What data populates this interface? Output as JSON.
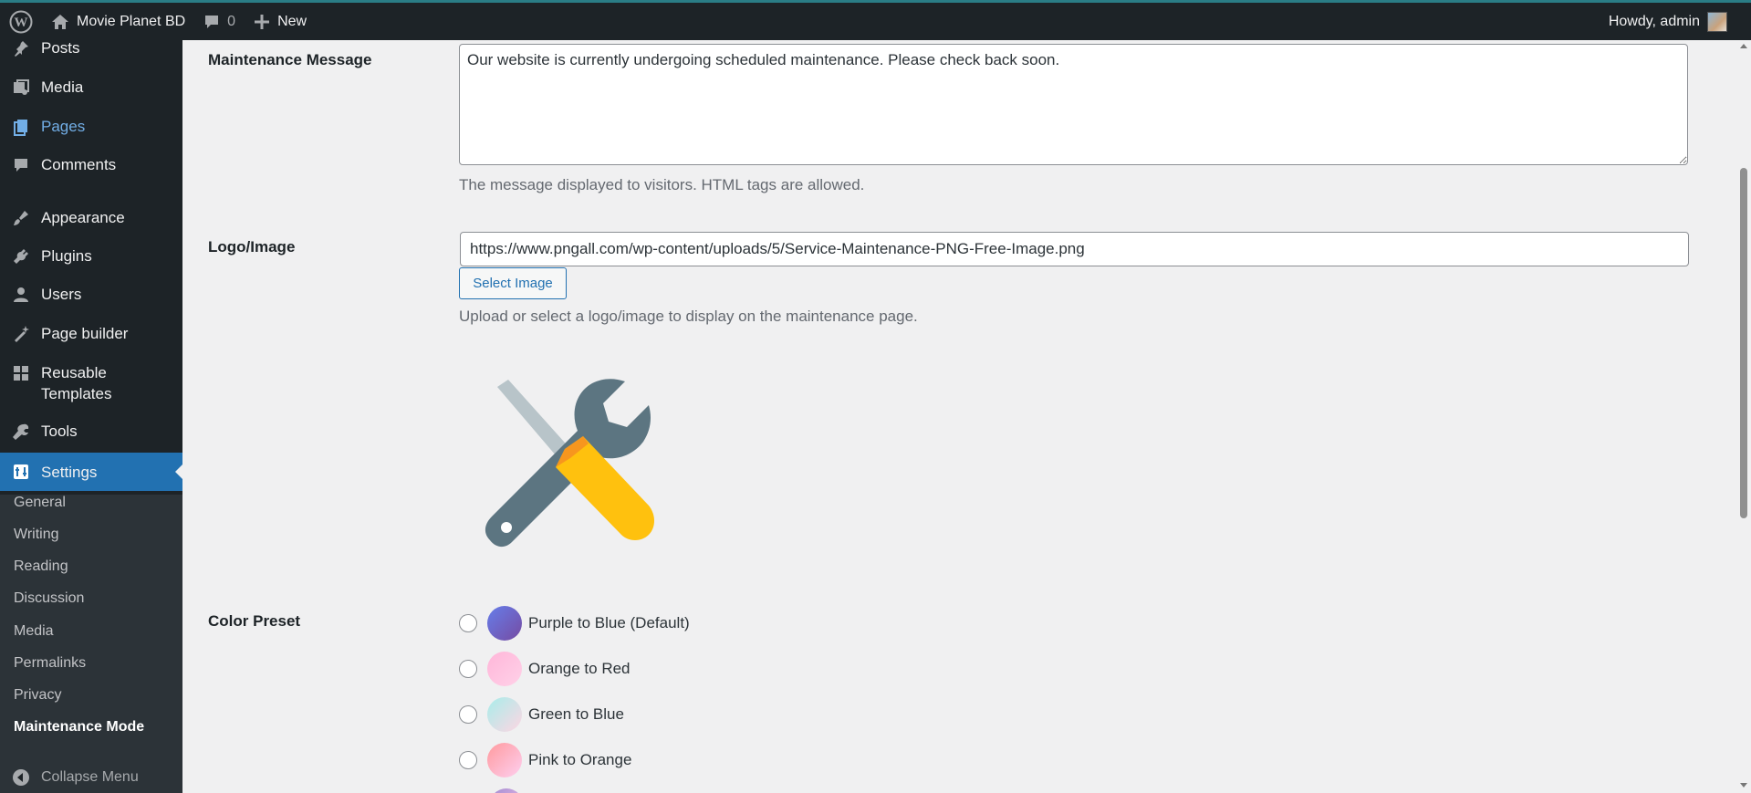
{
  "adminbar": {
    "site_name": "Movie Planet BD",
    "comments_count": "0",
    "new_label": "New",
    "howdy": "Howdy, admin"
  },
  "sidebar": {
    "items": [
      {
        "label": "Posts",
        "icon": "pin-icon"
      },
      {
        "label": "Media",
        "icon": "media-icon"
      },
      {
        "label": "Pages",
        "icon": "pages-icon"
      },
      {
        "label": "Comments",
        "icon": "comments-icon"
      },
      {
        "label": "Appearance",
        "icon": "appearance-icon"
      },
      {
        "label": "Plugins",
        "icon": "plugins-icon"
      },
      {
        "label": "Users",
        "icon": "users-icon"
      },
      {
        "label": "Page builder",
        "icon": "page-builder-icon"
      },
      {
        "label": "Reusable Templates",
        "icon": "templates-icon"
      },
      {
        "label": "Tools",
        "icon": "tools-icon"
      },
      {
        "label": "Settings",
        "icon": "settings-icon"
      }
    ],
    "submenu": [
      "General",
      "Writing",
      "Reading",
      "Discussion",
      "Media",
      "Permalinks",
      "Privacy",
      "Maintenance Mode"
    ],
    "collapse_label": "Collapse Menu"
  },
  "form": {
    "message_label": "Maintenance Message",
    "message_value": "Our website is currently undergoing scheduled maintenance. Please check back soon.",
    "message_desc": "The message displayed to visitors. HTML tags are allowed.",
    "logo_label": "Logo/Image",
    "logo_url": "https://www.pngall.com/wp-content/uploads/5/Service-Maintenance-PNG-Free-Image.png",
    "select_image": "Select Image",
    "logo_desc": "Upload or select a logo/image to display on the maintenance page.",
    "color_label": "Color Preset",
    "presets": [
      {
        "label": "Purple to Blue (Default)",
        "colors": [
          "#667eea",
          "#764ba2"
        ]
      },
      {
        "label": "Orange to Red",
        "colors": [
          "#ffb6d9",
          "#ffd1e8"
        ]
      },
      {
        "label": "Green to Blue",
        "colors": [
          "#a8edea",
          "#fed6e3"
        ]
      },
      {
        "label": "Pink to Orange",
        "colors": [
          "#ff9a9e",
          "#fecfef"
        ]
      }
    ]
  },
  "colors": {
    "adminbar_bg": "#1d2327",
    "accent": "#2271b1",
    "link": "#72aee6"
  }
}
